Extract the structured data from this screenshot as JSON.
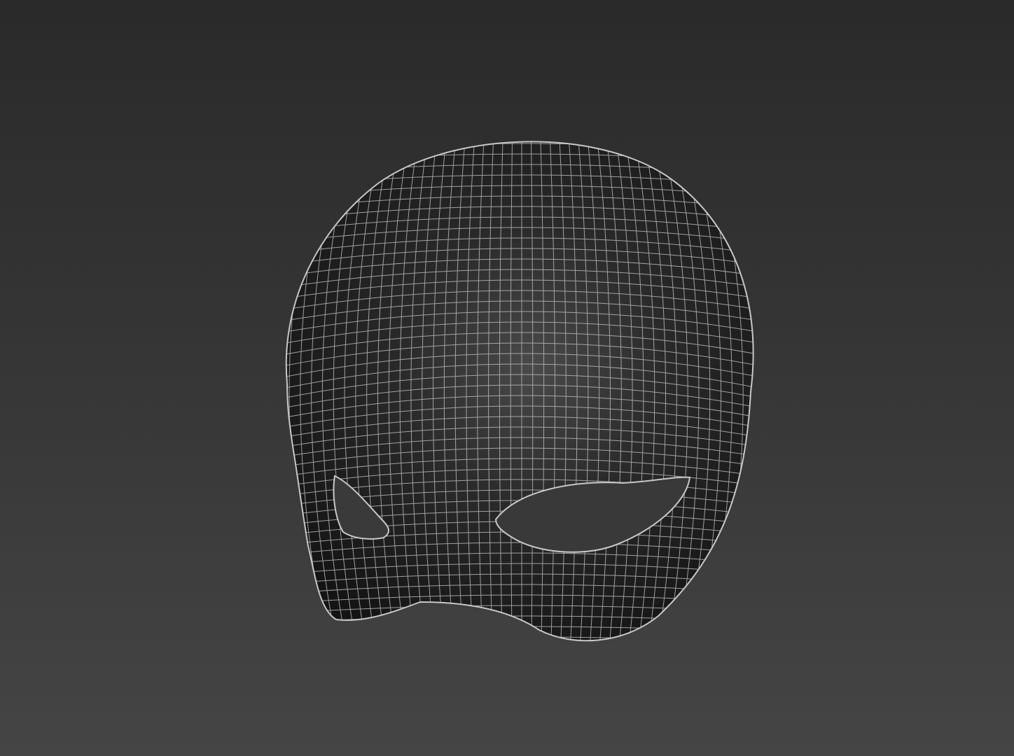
{
  "viewport": {
    "background_top": "#2a2a2a",
    "background_bottom": "#454545"
  },
  "model": {
    "object": "mask-icon",
    "display_mode": "wireframe-on-shaded",
    "surface_color": "#1f1f1f",
    "highlight_color": "#4a4a4a",
    "wire_color": "#b8b8b8"
  }
}
